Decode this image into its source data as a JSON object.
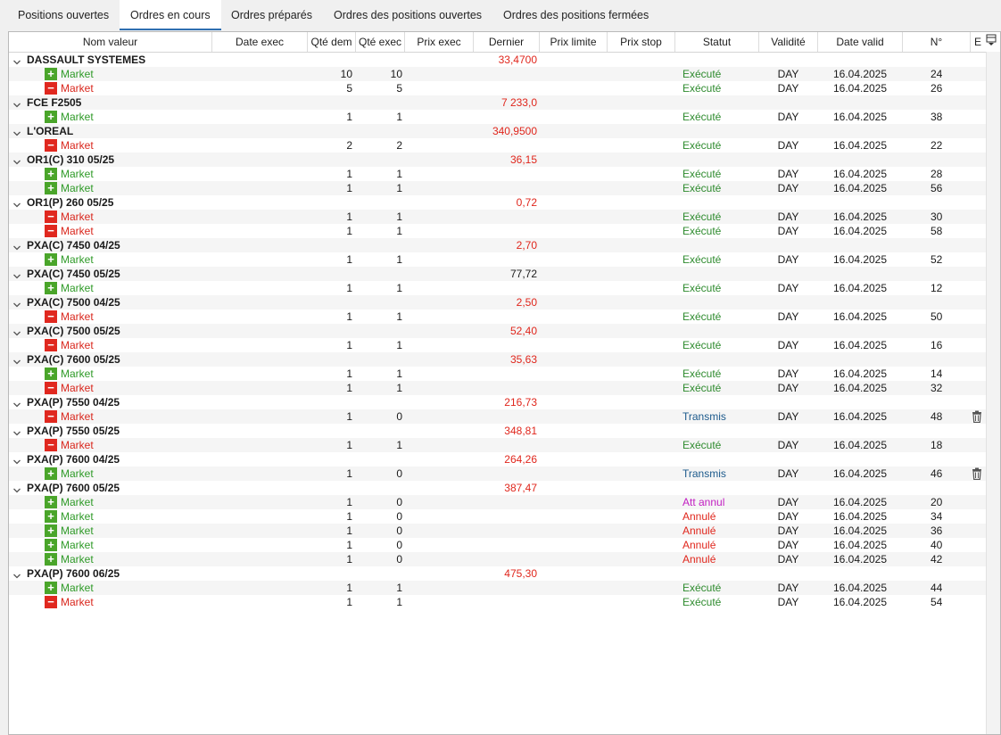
{
  "tabs": [
    {
      "label": "Positions ouvertes",
      "active": false
    },
    {
      "label": "Ordres en cours",
      "active": true
    },
    {
      "label": "Ordres préparés",
      "active": false
    },
    {
      "label": "Ordres des positions ouvertes",
      "active": false
    },
    {
      "label": "Ordres des positions fermées",
      "active": false
    }
  ],
  "columns": {
    "nom": "Nom valeur",
    "date_exec": "Date exec",
    "qte_dem": "Qté dem",
    "qte_exec": "Qté exec",
    "prix_exec": "Prix exec",
    "dernier": "Dernier",
    "prix_limite": "Prix limite",
    "prix_stop": "Prix stop",
    "statut": "Statut",
    "validite": "Validité",
    "date_valid": "Date valid",
    "num": "N°",
    "e": "E"
  },
  "colors": {
    "buy": "#4aa52a",
    "sell": "#e0281f",
    "executed": "#2e8b2e",
    "transmitted": "#1c5a8c",
    "pending_cancel": "#c21ec2",
    "cancelled": "#e0261c",
    "tab_accent": "#2f6fb0"
  },
  "groups": [
    {
      "name": "DASSAULT SYSTEMES",
      "last": "33,4700",
      "last_color": "red",
      "orders": [
        {
          "side": "buy",
          "type": "Market",
          "qte_dem": "10",
          "qte_exec": "10",
          "status": "Exécuté",
          "status_kind": "executed",
          "validity": "DAY",
          "date_valid": "16.04.2025",
          "num": "24"
        },
        {
          "side": "sell",
          "type": "Market",
          "qte_dem": "5",
          "qte_exec": "5",
          "status": "Exécuté",
          "status_kind": "executed",
          "validity": "DAY",
          "date_valid": "16.04.2025",
          "num": "26"
        }
      ]
    },
    {
      "name": "FCE F2505",
      "last": "7 233,0",
      "last_color": "red",
      "orders": [
        {
          "side": "buy",
          "type": "Market",
          "qte_dem": "1",
          "qte_exec": "1",
          "status": "Exécuté",
          "status_kind": "executed",
          "validity": "DAY",
          "date_valid": "16.04.2025",
          "num": "38"
        }
      ]
    },
    {
      "name": "L'OREAL",
      "last": "340,9500",
      "last_color": "red",
      "orders": [
        {
          "side": "sell",
          "type": "Market",
          "qte_dem": "2",
          "qte_exec": "2",
          "status": "Exécuté",
          "status_kind": "executed",
          "validity": "DAY",
          "date_valid": "16.04.2025",
          "num": "22"
        }
      ]
    },
    {
      "name": "OR1(C) 310 05/25",
      "last": "36,15",
      "last_color": "red",
      "orders": [
        {
          "side": "buy",
          "type": "Market",
          "qte_dem": "1",
          "qte_exec": "1",
          "status": "Exécuté",
          "status_kind": "executed",
          "validity": "DAY",
          "date_valid": "16.04.2025",
          "num": "28"
        },
        {
          "side": "buy",
          "type": "Market",
          "qte_dem": "1",
          "qte_exec": "1",
          "status": "Exécuté",
          "status_kind": "executed",
          "validity": "DAY",
          "date_valid": "16.04.2025",
          "num": "56"
        }
      ]
    },
    {
      "name": "OR1(P) 260 05/25",
      "last": "0,72",
      "last_color": "red",
      "orders": [
        {
          "side": "sell",
          "type": "Market",
          "qte_dem": "1",
          "qte_exec": "1",
          "status": "Exécuté",
          "status_kind": "executed",
          "validity": "DAY",
          "date_valid": "16.04.2025",
          "num": "30"
        },
        {
          "side": "sell",
          "type": "Market",
          "qte_dem": "1",
          "qte_exec": "1",
          "status": "Exécuté",
          "status_kind": "executed",
          "validity": "DAY",
          "date_valid": "16.04.2025",
          "num": "58"
        }
      ]
    },
    {
      "name": "PXA(C) 7450 04/25",
      "last": "2,70",
      "last_color": "red",
      "orders": [
        {
          "side": "buy",
          "type": "Market",
          "qte_dem": "1",
          "qte_exec": "1",
          "status": "Exécuté",
          "status_kind": "executed",
          "validity": "DAY",
          "date_valid": "16.04.2025",
          "num": "52"
        }
      ]
    },
    {
      "name": "PXA(C) 7450 05/25",
      "last": "77,72",
      "last_color": "black",
      "orders": [
        {
          "side": "buy",
          "type": "Market",
          "qte_dem": "1",
          "qte_exec": "1",
          "status": "Exécuté",
          "status_kind": "executed",
          "validity": "DAY",
          "date_valid": "16.04.2025",
          "num": "12"
        }
      ]
    },
    {
      "name": "PXA(C) 7500 04/25",
      "last": "2,50",
      "last_color": "red",
      "orders": [
        {
          "side": "sell",
          "type": "Market",
          "qte_dem": "1",
          "qte_exec": "1",
          "status": "Exécuté",
          "status_kind": "executed",
          "validity": "DAY",
          "date_valid": "16.04.2025",
          "num": "50"
        }
      ]
    },
    {
      "name": "PXA(C) 7500 05/25",
      "last": "52,40",
      "last_color": "red",
      "orders": [
        {
          "side": "sell",
          "type": "Market",
          "qte_dem": "1",
          "qte_exec": "1",
          "status": "Exécuté",
          "status_kind": "executed",
          "validity": "DAY",
          "date_valid": "16.04.2025",
          "num": "16"
        }
      ]
    },
    {
      "name": "PXA(C) 7600 05/25",
      "last": "35,63",
      "last_color": "red",
      "orders": [
        {
          "side": "buy",
          "type": "Market",
          "qte_dem": "1",
          "qte_exec": "1",
          "status": "Exécuté",
          "status_kind": "executed",
          "validity": "DAY",
          "date_valid": "16.04.2025",
          "num": "14"
        },
        {
          "side": "sell",
          "type": "Market",
          "qte_dem": "1",
          "qte_exec": "1",
          "status": "Exécuté",
          "status_kind": "executed",
          "validity": "DAY",
          "date_valid": "16.04.2025",
          "num": "32"
        }
      ]
    },
    {
      "name": "PXA(P) 7550 04/25",
      "last": "216,73",
      "last_color": "red",
      "orders": [
        {
          "side": "sell",
          "type": "Market",
          "qte_dem": "1",
          "qte_exec": "0",
          "status": "Transmis",
          "status_kind": "transmitted",
          "validity": "DAY",
          "date_valid": "16.04.2025",
          "num": "48",
          "trash": true
        }
      ]
    },
    {
      "name": "PXA(P) 7550 05/25",
      "last": "348,81",
      "last_color": "red",
      "orders": [
        {
          "side": "sell",
          "type": "Market",
          "qte_dem": "1",
          "qte_exec": "1",
          "status": "Exécuté",
          "status_kind": "executed",
          "validity": "DAY",
          "date_valid": "16.04.2025",
          "num": "18"
        }
      ]
    },
    {
      "name": "PXA(P) 7600 04/25",
      "last": "264,26",
      "last_color": "red",
      "orders": [
        {
          "side": "buy",
          "type": "Market",
          "qte_dem": "1",
          "qte_exec": "0",
          "status": "Transmis",
          "status_kind": "transmitted",
          "validity": "DAY",
          "date_valid": "16.04.2025",
          "num": "46",
          "trash": true
        }
      ]
    },
    {
      "name": "PXA(P) 7600 05/25",
      "last": "387,47",
      "last_color": "red",
      "orders": [
        {
          "side": "buy",
          "type": "Market",
          "qte_dem": "1",
          "qte_exec": "0",
          "status": "Att annul",
          "status_kind": "pending_cancel",
          "validity": "DAY",
          "date_valid": "16.04.2025",
          "num": "20"
        },
        {
          "side": "buy",
          "type": "Market",
          "qte_dem": "1",
          "qte_exec": "0",
          "status": "Annulé",
          "status_kind": "cancelled",
          "validity": "DAY",
          "date_valid": "16.04.2025",
          "num": "34"
        },
        {
          "side": "buy",
          "type": "Market",
          "qte_dem": "1",
          "qte_exec": "0",
          "status": "Annulé",
          "status_kind": "cancelled",
          "validity": "DAY",
          "date_valid": "16.04.2025",
          "num": "36"
        },
        {
          "side": "buy",
          "type": "Market",
          "qte_dem": "1",
          "qte_exec": "0",
          "status": "Annulé",
          "status_kind": "cancelled",
          "validity": "DAY",
          "date_valid": "16.04.2025",
          "num": "40"
        },
        {
          "side": "buy",
          "type": "Market",
          "qte_dem": "1",
          "qte_exec": "0",
          "status": "Annulé",
          "status_kind": "cancelled",
          "validity": "DAY",
          "date_valid": "16.04.2025",
          "num": "42"
        }
      ]
    },
    {
      "name": "PXA(P) 7600 06/25",
      "last": "475,30",
      "last_color": "red",
      "orders": [
        {
          "side": "buy",
          "type": "Market",
          "qte_dem": "1",
          "qte_exec": "1",
          "status": "Exécuté",
          "status_kind": "executed",
          "validity": "DAY",
          "date_valid": "16.04.2025",
          "num": "44"
        },
        {
          "side": "sell",
          "type": "Market",
          "qte_dem": "1",
          "qte_exec": "1",
          "status": "Exécuté",
          "status_kind": "executed",
          "validity": "DAY",
          "date_valid": "16.04.2025",
          "num": "54"
        }
      ]
    }
  ]
}
